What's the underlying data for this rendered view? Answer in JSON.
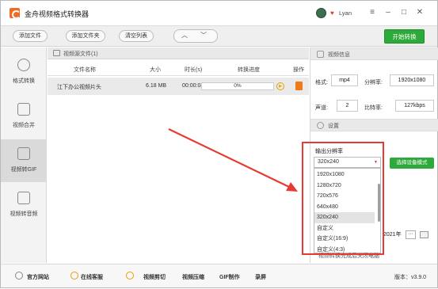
{
  "app": {
    "title": "金舟视频格式转换器",
    "username": "Lyan"
  },
  "toolbar": {
    "add_file": "添加文件",
    "add_folder": "添加文件夹",
    "clear_list": "清空列表",
    "start": "开始转换"
  },
  "sidebar": {
    "items": [
      {
        "label": "格式转换"
      },
      {
        "label": "视频合并"
      },
      {
        "label": "视频转GIF"
      },
      {
        "label": "视频转音频"
      }
    ]
  },
  "file_panel": {
    "title": "视频源文件(1)",
    "columns": [
      "文件名称",
      "大小",
      "时长(s)",
      "转换进度",
      "操作"
    ],
    "rows": [
      {
        "name": "江下办公视频片头",
        "size": "6.18 MB",
        "duration": "00:00:04",
        "progress": "0%"
      }
    ]
  },
  "info_panel": {
    "title": "视频信息",
    "format_label": "格式:",
    "format": "mp4",
    "resolution_label": "分辨率:",
    "resolution": "1920x1080",
    "channel_label": "声道:",
    "channel": "2",
    "bitrate_label": "比特率:",
    "bitrate": "127kbps",
    "settings_title": "设置",
    "output_res_label": "输出分辨率",
    "output_res_selected": "320x240",
    "output_res_options": [
      "1920x1080",
      "1280x720",
      "720x576",
      "640x480",
      "320x240",
      "自定义",
      "自定义(16:9)",
      "自定义(4:3)"
    ],
    "device_button": "选择设备模式",
    "date_partial": "2021年",
    "more": "···",
    "hidden_option": "视频转换完成后关闭电脑"
  },
  "footer": {
    "items": [
      "官方网站",
      "在线客服",
      "视频剪切",
      "视频压缩",
      "GIF制作",
      "录屏"
    ],
    "version": "版本：v3.9.0"
  },
  "colors": {
    "accent_green": "#2eaa3c",
    "highlight_red": "#e53b30",
    "brand_orange": "#f36b20"
  }
}
